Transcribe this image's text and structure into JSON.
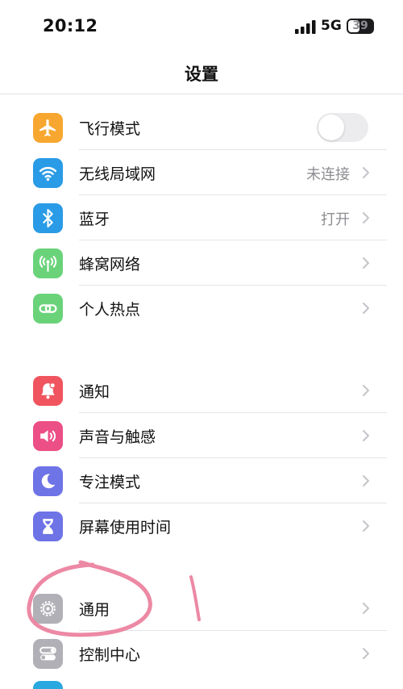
{
  "status_bar": {
    "time": "20:12",
    "network": "5G",
    "battery": "39"
  },
  "header": {
    "title": "设置"
  },
  "groups": [
    {
      "items": [
        {
          "label": "飞行模式",
          "icon": "airplane-icon",
          "color": "#f7a730",
          "control": "toggle",
          "toggle_on": false
        },
        {
          "label": "无线局域网",
          "icon": "wifi-icon",
          "color": "#2a9be6",
          "value": "未连接"
        },
        {
          "label": "蓝牙",
          "icon": "bluetooth-icon",
          "color": "#2a9be6",
          "value": "打开"
        },
        {
          "label": "蜂窝网络",
          "icon": "antenna-icon",
          "color": "#6ad37a"
        },
        {
          "label": "个人热点",
          "icon": "chain-link-icon",
          "color": "#6ad37a"
        }
      ]
    },
    {
      "items": [
        {
          "label": "通知",
          "icon": "bell-icon",
          "color": "#f0555f"
        },
        {
          "label": "声音与触感",
          "icon": "speaker-icon",
          "color": "#ec4f86"
        },
        {
          "label": "专注模式",
          "icon": "moon-icon",
          "color": "#6e73e6"
        },
        {
          "label": "屏幕使用时间",
          "icon": "hourglass-icon",
          "color": "#6e73e6"
        }
      ]
    },
    {
      "items": [
        {
          "label": "通用",
          "icon": "gear-icon",
          "color": "#b0b0b6"
        },
        {
          "label": "控制中心",
          "icon": "toggles-icon",
          "color": "#b0b0b6"
        }
      ]
    }
  ]
}
